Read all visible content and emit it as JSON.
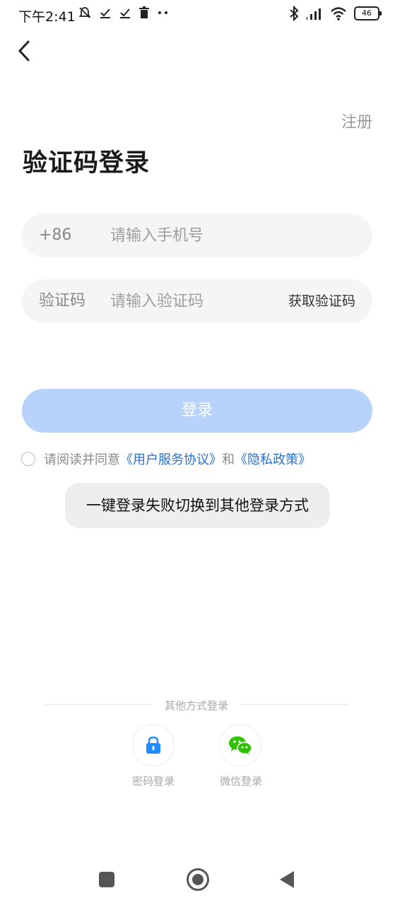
{
  "status_bar": {
    "time": "下午2:41",
    "battery": "46",
    "left_icons": [
      "mute-bell-icon",
      "check-icon",
      "check-icon",
      "trash-icon",
      "more-dots-icon"
    ],
    "right_icons": [
      "bluetooth-icon",
      "signal-icon",
      "wifi-icon",
      "battery-icon"
    ]
  },
  "header": {
    "back_icon": "chevron-left-icon",
    "register_label": "注册"
  },
  "page": {
    "title": "验证码登录"
  },
  "form": {
    "phone": {
      "prefix": "+86",
      "placeholder": "请输入手机号",
      "value": ""
    },
    "code": {
      "prefix": "验证码",
      "placeholder": "请输入验证码",
      "value": "",
      "get_code_label": "获取验证码"
    },
    "login_label": "登录",
    "login_color": "#b8d3fb"
  },
  "agreement": {
    "checked": false,
    "prefix_text": "请阅读并同意",
    "terms_link": "《用户服务协议》",
    "and_text": "和",
    "privacy_link": "《隐私政策》",
    "link_color": "#2b6fd1"
  },
  "switch_button_label": "一键登录失败切换到其他登录方式",
  "other_methods": {
    "label": "其他方式登录",
    "items": [
      {
        "icon": "lock-icon",
        "label": "密码登录",
        "color": "#1e8cff"
      },
      {
        "icon": "wechat-icon",
        "label": "微信登录",
        "color": "#2dc100"
      }
    ]
  },
  "nav_bar": {
    "icons": [
      "recents-square-icon",
      "home-circle-icon",
      "back-triangle-icon"
    ]
  }
}
